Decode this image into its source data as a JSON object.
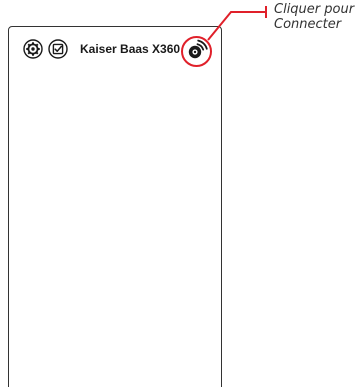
{
  "header": {
    "device_name": "Kaiser Baas X360"
  },
  "icons": {
    "settings": "settings-icon",
    "checkbox": "checkbox-icon",
    "connect": "wifi-camera-icon"
  },
  "annotation": {
    "line1": "Cliquer pour",
    "line2": "Connecter"
  },
  "colors": {
    "highlight": "#e0202a",
    "text": "#1a1a1a",
    "border": "#333333"
  }
}
